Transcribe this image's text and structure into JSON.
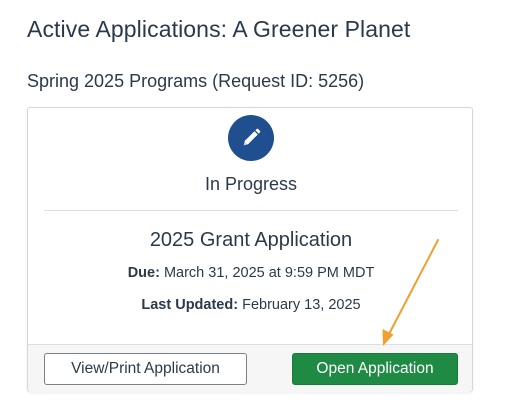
{
  "page_title": "Active Applications: A Greener Planet",
  "section_title": "Spring 2025 Programs (Request ID: 5256)",
  "card": {
    "status_icon": "pencil-icon",
    "status_label": "In Progress",
    "application_title": "2025 Grant Application",
    "due_key": "Due:",
    "due_value": "March 31, 2025 at 9:59 PM MDT",
    "updated_key": "Last Updated:",
    "updated_value": "February 13, 2025",
    "buttons": {
      "view_print_label": "View/Print Application",
      "open_label": "Open Application"
    }
  },
  "colors": {
    "status_circle": "#1f4f8f",
    "primary_button": "#1f8a44",
    "annotation_arrow": "#f0a030"
  }
}
